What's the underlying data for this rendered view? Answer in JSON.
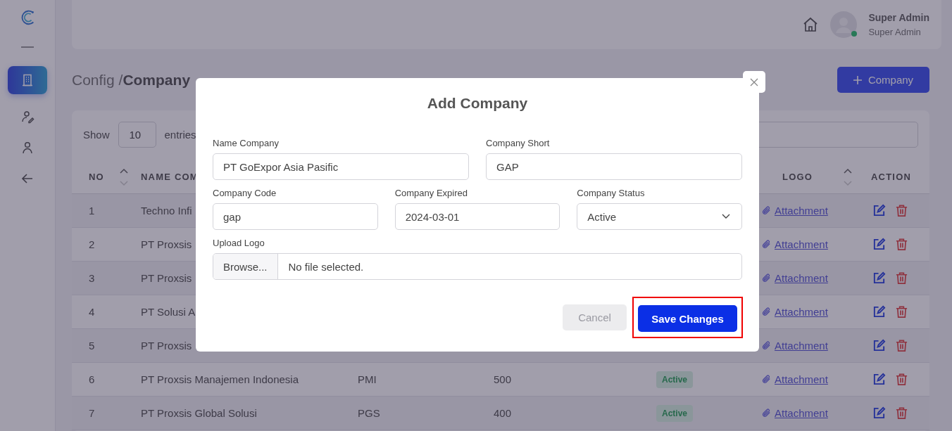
{
  "sidebar": {
    "items": [
      {
        "selected": true
      },
      {
        "selected": false
      },
      {
        "selected": false
      },
      {
        "selected": false
      }
    ]
  },
  "header": {
    "user_name": "Super Admin",
    "user_role": "Super Admin",
    "online": true
  },
  "breadcrumb": {
    "parent": "Config",
    "separator": "/",
    "current": "Company"
  },
  "add_button": {
    "label": "Company"
  },
  "table": {
    "show_label": "Show",
    "page_size": "10",
    "entries_label": "entries",
    "columns": [
      {
        "label": "NO",
        "sortable": true
      },
      {
        "label": "NAME COM",
        "sortable": false
      },
      {
        "label": "LOGO",
        "sortable": true
      },
      {
        "label": "ACTION",
        "sortable": false
      }
    ],
    "rows": [
      {
        "no": "1",
        "name": "Techno Infi",
        "logo": "Attachment"
      },
      {
        "no": "2",
        "name": "PT Proxsis",
        "logo": "Attachment"
      },
      {
        "no": "3",
        "name": "PT Proxsis",
        "logo": "Attachment"
      },
      {
        "no": "4",
        "name": "PT Solusi A",
        "logo": "Attachment"
      },
      {
        "no": "5",
        "name": "PT Proxsis",
        "logo": "Attachment"
      },
      {
        "no": "6",
        "name": "PT Proxsis Manajemen Indonesia",
        "code": "PMI",
        "number": "500",
        "status": "Active",
        "logo": "Attachment"
      },
      {
        "no": "7",
        "name": "PT Proxsis Global Solusi",
        "code": "PGS",
        "number": "400",
        "status": "Active",
        "logo": "Attachment"
      }
    ]
  },
  "modal": {
    "title": "Add Company",
    "field_rows": [
      [
        {
          "label": "Name Company",
          "value": "PT GoExpor Asia Pasific",
          "kind": "text"
        },
        {
          "label": "Company Short",
          "value": "GAP",
          "kind": "text"
        }
      ],
      [
        {
          "label": "Company Code",
          "value": "gap",
          "kind": "text"
        },
        {
          "label": "Company Expired",
          "value": "2024-03-01",
          "kind": "text"
        },
        {
          "label": "Company Status",
          "value": "Active",
          "kind": "select"
        }
      ]
    ],
    "upload": {
      "label": "Upload Logo",
      "button": "Browse...",
      "value": "No file selected."
    },
    "cancel": {
      "label": "Cancel",
      "disabled": true
    },
    "save": {
      "label": "Save Changes",
      "highlighted": true
    }
  }
}
